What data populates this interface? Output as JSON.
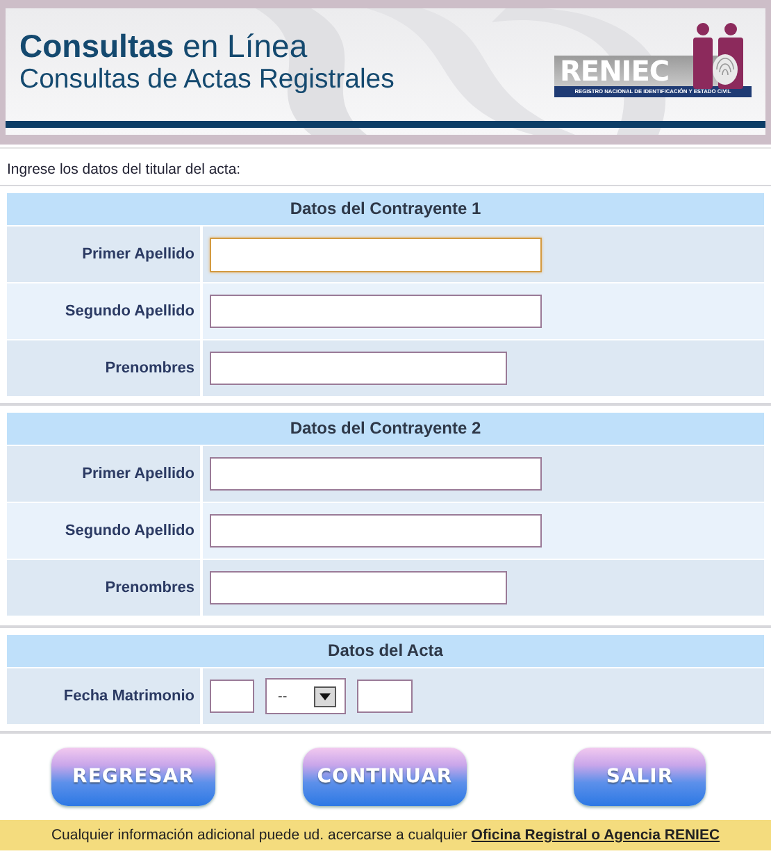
{
  "header": {
    "title_bold": "Consultas",
    "title_rest": "en Línea",
    "subtitle": "Consultas de Actas Registrales",
    "logo": {
      "name": "RENIEC",
      "tagline": "REGISTRO NACIONAL DE IDENTIFICACIÓN Y ESTADO CIVIL"
    }
  },
  "instruction": "Ingrese los datos del titular del acta:",
  "sections": [
    {
      "title": "Datos del Contrayente 1",
      "fields": [
        {
          "label": "Primer Apellido",
          "kind": "long",
          "focused": true
        },
        {
          "label": "Segundo Apellido",
          "kind": "long",
          "focused": false
        },
        {
          "label": "Prenombres",
          "kind": "short",
          "focused": false
        }
      ]
    },
    {
      "title": "Datos del Contrayente 2",
      "fields": [
        {
          "label": "Primer Apellido",
          "kind": "long",
          "focused": false
        },
        {
          "label": "Segundo Apellido",
          "kind": "long",
          "focused": false
        },
        {
          "label": "Prenombres",
          "kind": "short",
          "focused": false
        }
      ]
    },
    {
      "title": "Datos del Acta",
      "fields": [
        {
          "label": "Fecha Matrimonio",
          "kind": "date",
          "month": "--"
        }
      ]
    }
  ],
  "buttons": [
    "REGRESAR",
    "CONTINUAR",
    "SALIR"
  ],
  "footer": {
    "text": "Cualquier información adicional puede ud. acercarse a cualquier",
    "link": "Oficina Registral o Agencia RENIEC"
  }
}
